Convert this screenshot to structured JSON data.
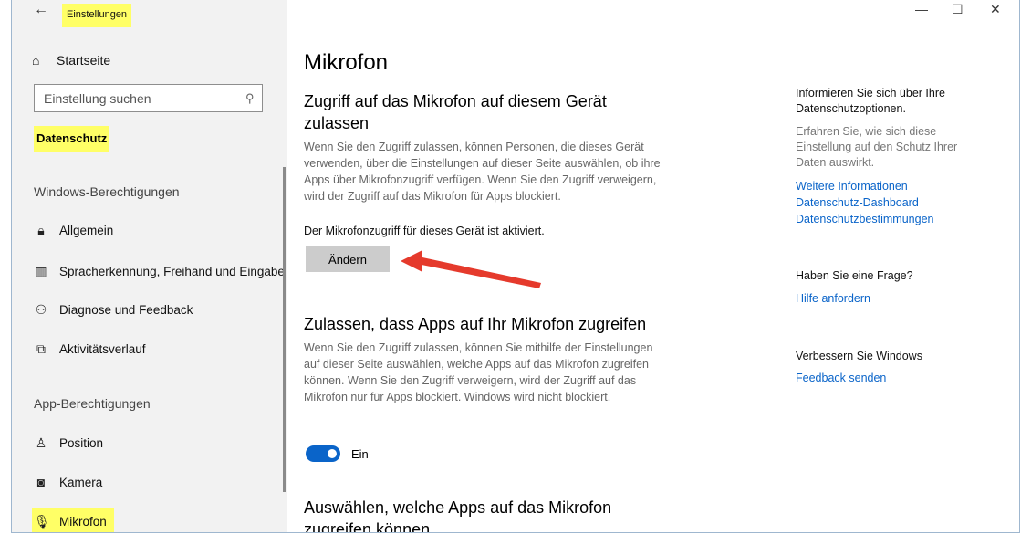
{
  "window": {
    "title": "Einstellungen",
    "controls": {
      "minimize": "—",
      "maximize": "☐",
      "close": "✕"
    }
  },
  "sidebar": {
    "home": "Startseite",
    "search_placeholder": "Einstellung suchen",
    "section": "Datenschutz",
    "group_windows": "Windows-Berechtigungen",
    "windows_items": [
      {
        "label": "Allgemein",
        "icon": "lock-icon"
      },
      {
        "label": "Spracherkennung, Freihand und Eingabe",
        "icon": "speech-icon"
      },
      {
        "label": "Diagnose und Feedback",
        "icon": "feedback-icon"
      },
      {
        "label": "Aktivitätsverlauf",
        "icon": "activity-icon"
      }
    ],
    "group_app": "App-Berechtigungen",
    "app_items": [
      {
        "label": "Position",
        "icon": "location-icon"
      },
      {
        "label": "Kamera",
        "icon": "camera-icon"
      },
      {
        "label": "Mikrofon",
        "icon": "microphone-icon"
      }
    ]
  },
  "main": {
    "title": "Mikrofon",
    "section1": {
      "heading_line1": "Zugriff auf das Mikrofon auf diesem Gerät",
      "heading_line2": "zulassen",
      "description": "Wenn Sie den Zugriff zulassen, können Personen, die dieses Gerät verwenden, über die Einstellungen auf dieser Seite auswählen, ob ihre Apps über Mikrofonzugriff verfügen. Wenn Sie den Zugriff verweigern, wird der Zugriff auf das Mikrofon für Apps blockiert.",
      "status": "Der Mikrofonzugriff für dieses Gerät ist aktiviert.",
      "button": "Ändern"
    },
    "section2": {
      "heading": "Zulassen, dass Apps auf Ihr Mikrofon zugreifen",
      "description": "Wenn Sie den Zugriff zulassen, können Sie mithilfe der Einstellungen auf dieser Seite auswählen, welche Apps auf das Mikrofon zugreifen können. Wenn Sie den Zugriff verweigern, wird der Zugriff auf das Mikrofon nur für Apps blockiert. Windows wird nicht blockiert.",
      "toggle_label": "Ein",
      "toggle_on": true
    },
    "section3": {
      "heading_line1": "Auswählen, welche Apps auf das Mikrofon",
      "heading_line2": "zugreifen können"
    }
  },
  "right": {
    "privacy_heading": "Informieren Sie sich über Ihre Datenschutzoptionen.",
    "privacy_text": "Erfahren Sie, wie sich diese Einstellung auf den Schutz Ihrer Daten auswirkt.",
    "links": [
      "Weitere Informationen",
      "Datenschutz-Dashboard",
      "Datenschutzbestimmungen"
    ],
    "question_heading": "Haben Sie eine Frage?",
    "help_link": "Hilfe anfordern",
    "improve_heading": "Verbessern Sie Windows",
    "feedback_link": "Feedback senden"
  },
  "colors": {
    "highlight": "#ffff66",
    "accent": "#0a64c9",
    "annotation_arrow": "#e53a2c",
    "sidebar_bg": "#f2f2f2"
  }
}
